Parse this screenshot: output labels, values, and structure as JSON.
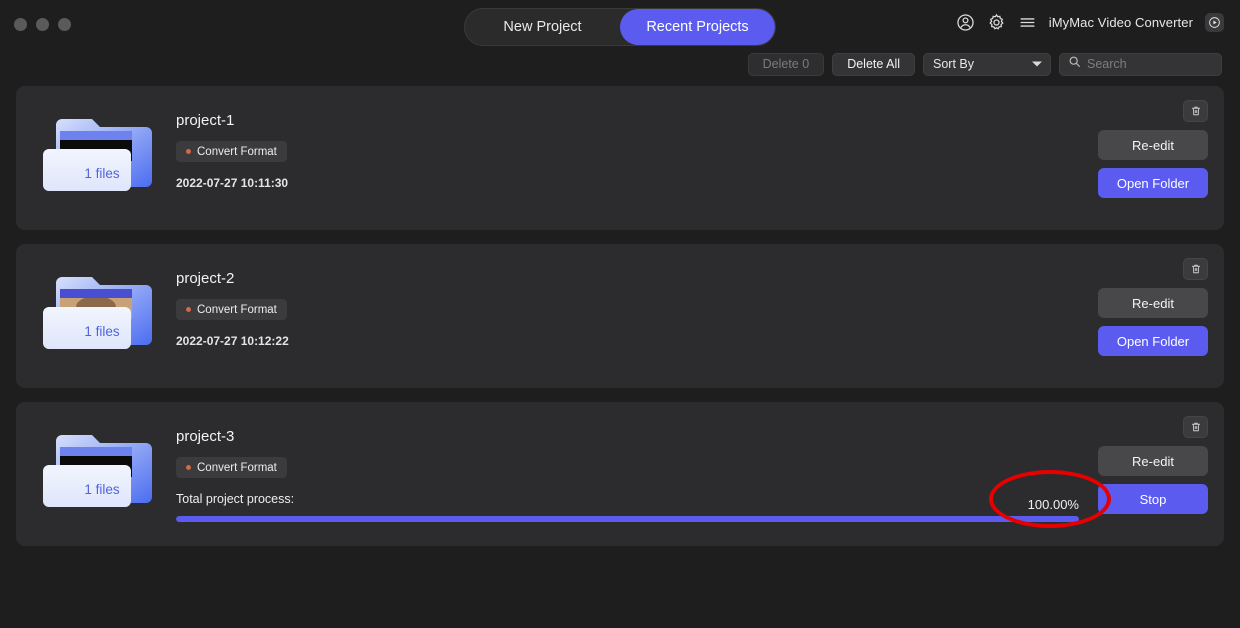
{
  "window": {
    "traffic_lights": [
      "close",
      "minimize",
      "maximize"
    ]
  },
  "header": {
    "tabs": [
      {
        "label": "New Project",
        "active": false
      },
      {
        "label": "Recent Projects",
        "active": true
      }
    ],
    "app_title": "iMyMac Video Converter",
    "icons": [
      "account-icon",
      "gear-icon",
      "hamburger-menu-icon",
      "play-badge-icon"
    ]
  },
  "toolbar": {
    "delete_count_label": "Delete 0",
    "delete_all_label": "Delete All",
    "sort_by_label": "Sort By",
    "search_placeholder": "Search",
    "search_value": ""
  },
  "projects": [
    {
      "name": "project-1",
      "files_label": "1 files",
      "badge": "Convert Format",
      "timestamp": "2022-07-27 10:11:30",
      "thumb_color": "#0b0b0b",
      "primary_action": "Open Folder",
      "secondary_action": "Re-edit",
      "has_progress": false
    },
    {
      "name": "project-2",
      "files_label": "1 files",
      "badge": "Convert Format",
      "timestamp": "2022-07-27 10:12:22",
      "thumb_color": "#c9a176",
      "primary_action": "Open Folder",
      "secondary_action": "Re-edit",
      "has_progress": false
    },
    {
      "name": "project-3",
      "files_label": "1 files",
      "badge": "Convert Format",
      "progress_label": "Total project process:",
      "progress_percent_label": "100.00%",
      "progress_percent": 100,
      "thumb_color": "#0b0b0b",
      "primary_action": "Stop",
      "secondary_action": "Re-edit",
      "has_progress": true
    }
  ],
  "annotation": {
    "shape": "red-ellipse-highlight",
    "target": "100.00%",
    "color": "#e60000"
  },
  "colors": {
    "accent": "#5b5bf0",
    "page_bg": "#1e1e1e",
    "card_bg": "#2c2c2e",
    "badge_dot": "#d4684a",
    "files_text": "#4f63dd"
  }
}
